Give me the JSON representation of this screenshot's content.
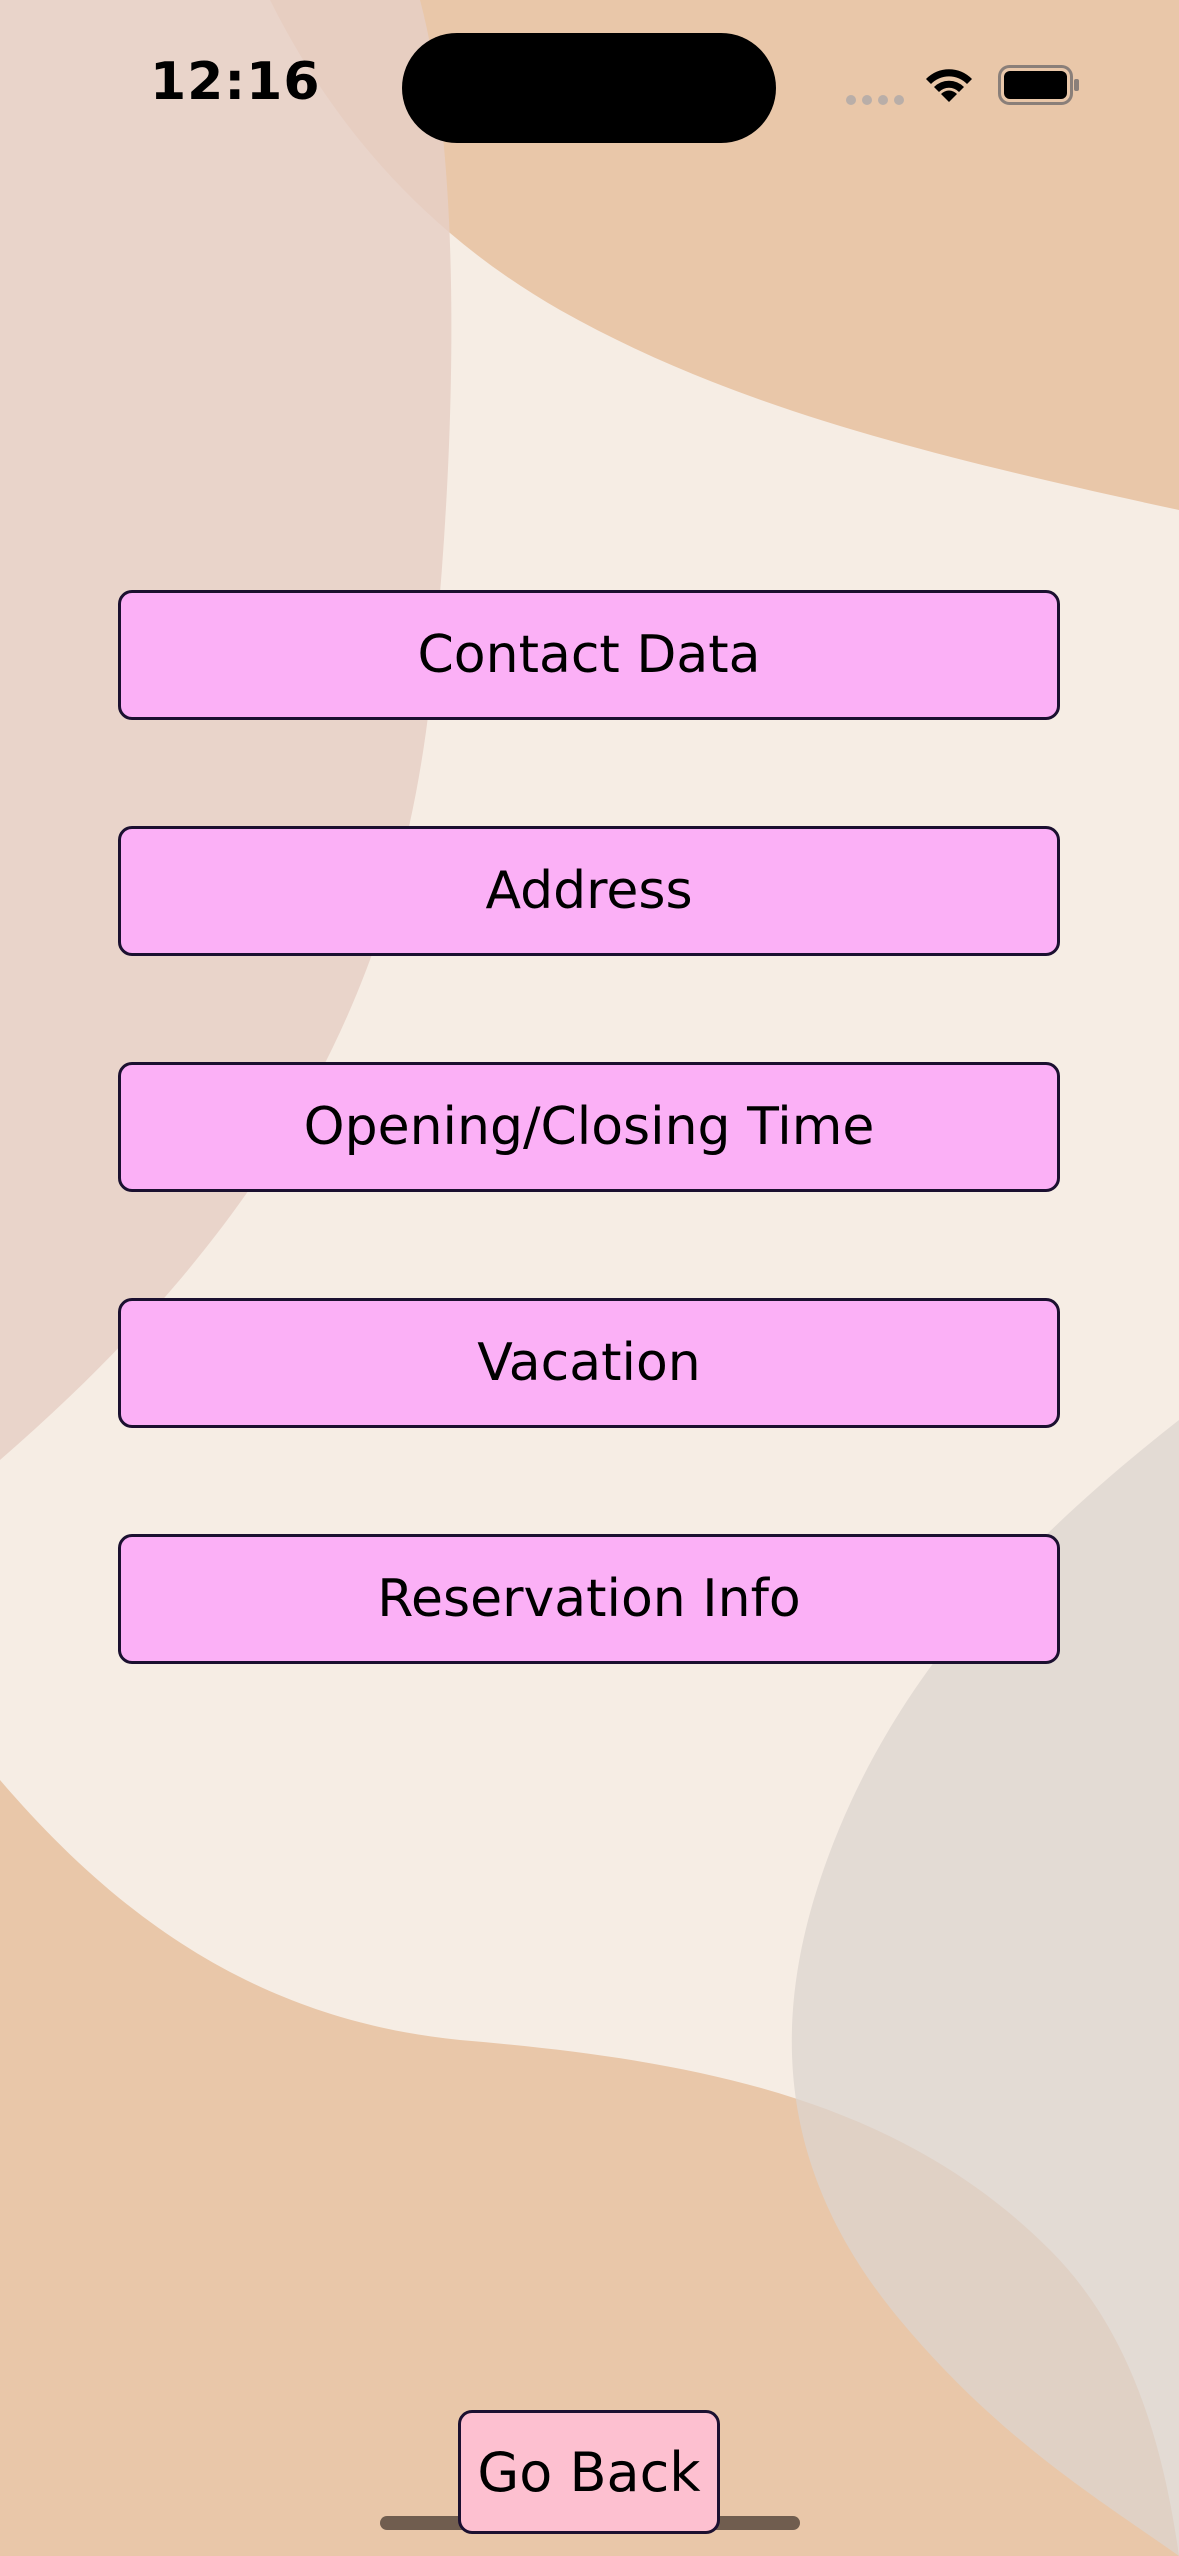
{
  "status_bar": {
    "time": "12:16",
    "icons": [
      "cellular-signal-icon",
      "wifi-icon",
      "battery-icon"
    ]
  },
  "menu": {
    "items": [
      {
        "label": "Contact Data"
      },
      {
        "label": "Address"
      },
      {
        "label": "Opening/Closing Time"
      },
      {
        "label": "Vacation"
      },
      {
        "label": "Reservation Info"
      }
    ]
  },
  "footer": {
    "go_back_label": "Go Back"
  },
  "colors": {
    "background": "#f6ede4",
    "accent_shape": "#e9c7a9",
    "pink_shape": "#ead5cd",
    "grey_shape": "#e3ddd8",
    "button_fill": "#fbb0f6",
    "go_back_fill": "#fdc0d0",
    "button_border": "#1b1030"
  }
}
